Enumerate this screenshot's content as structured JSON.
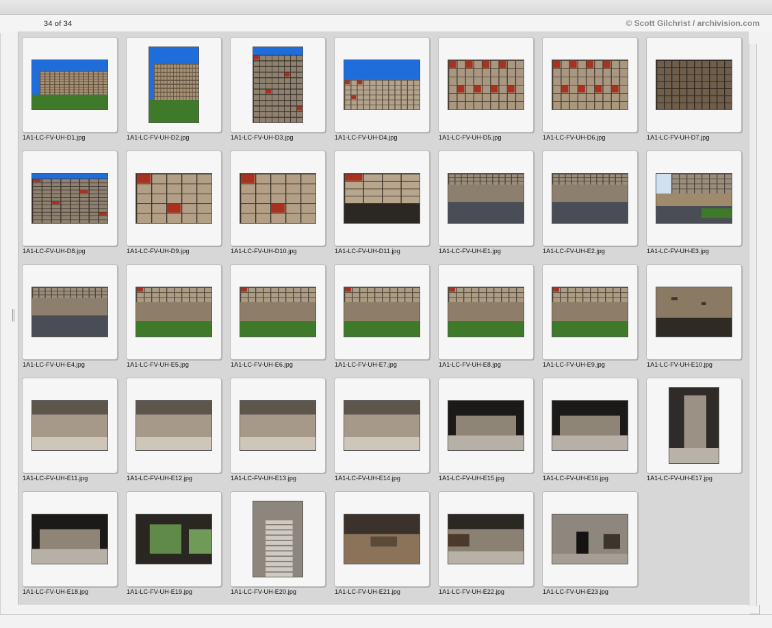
{
  "header": {
    "counter": "34 of 34",
    "credit": "© Scott Gilchrist / archivision.com"
  },
  "thumbnails": [
    {
      "filename": "1A1-LC-FV-UH-D1.jpg",
      "orientation": "landscape",
      "scene": "facade-sky-lawn"
    },
    {
      "filename": "1A1-LC-FV-UH-D2.jpg",
      "orientation": "portrait",
      "scene": "facade-sky-lawn"
    },
    {
      "filename": "1A1-LC-FV-UH-D3.jpg",
      "orientation": "portrait",
      "scene": "facade-grid"
    },
    {
      "filename": "1A1-LC-FV-UH-D4.jpg",
      "orientation": "landscape",
      "scene": "facade-sky-top"
    },
    {
      "filename": "1A1-LC-FV-UH-D5.jpg",
      "orientation": "landscape",
      "scene": "facade-grid-red"
    },
    {
      "filename": "1A1-LC-FV-UH-D6.jpg",
      "orientation": "landscape",
      "scene": "facade-grid-red"
    },
    {
      "filename": "1A1-LC-FV-UH-D7.jpg",
      "orientation": "landscape",
      "scene": "facade-grid-dark"
    },
    {
      "filename": "1A1-LC-FV-UH-D8.jpg",
      "orientation": "landscape",
      "scene": "facade-grid"
    },
    {
      "filename": "1A1-LC-FV-UH-D9.jpg",
      "orientation": "landscape",
      "scene": "balconies"
    },
    {
      "filename": "1A1-LC-FV-UH-D10.jpg",
      "orientation": "landscape",
      "scene": "balconies"
    },
    {
      "filename": "1A1-LC-FV-UH-D11.jpg",
      "orientation": "landscape",
      "scene": "balconies-dark"
    },
    {
      "filename": "1A1-LC-FV-UH-E1.jpg",
      "orientation": "landscape",
      "scene": "pilotis-road"
    },
    {
      "filename": "1A1-LC-FV-UH-E2.jpg",
      "orientation": "landscape",
      "scene": "pilotis-road"
    },
    {
      "filename": "1A1-LC-FV-UH-E3.jpg",
      "orientation": "landscape",
      "scene": "pilotis-road-green"
    },
    {
      "filename": "1A1-LC-FV-UH-E4.jpg",
      "orientation": "landscape",
      "scene": "pilotis-road"
    },
    {
      "filename": "1A1-LC-FV-UH-E5.jpg",
      "orientation": "landscape",
      "scene": "pilotis-lawn"
    },
    {
      "filename": "1A1-LC-FV-UH-E6.jpg",
      "orientation": "landscape",
      "scene": "pilotis-lawn"
    },
    {
      "filename": "1A1-LC-FV-UH-E7.jpg",
      "orientation": "landscape",
      "scene": "pilotis-lawn"
    },
    {
      "filename": "1A1-LC-FV-UH-E8.jpg",
      "orientation": "landscape",
      "scene": "pilotis-lawn"
    },
    {
      "filename": "1A1-LC-FV-UH-E9.jpg",
      "orientation": "landscape",
      "scene": "pilotis-lawn"
    },
    {
      "filename": "1A1-LC-FV-UH-E10.jpg",
      "orientation": "landscape",
      "scene": "concrete-wall"
    },
    {
      "filename": "1A1-LC-FV-UH-E11.jpg",
      "orientation": "landscape",
      "scene": "undercroft"
    },
    {
      "filename": "1A1-LC-FV-UH-E12.jpg",
      "orientation": "landscape",
      "scene": "undercroft"
    },
    {
      "filename": "1A1-LC-FV-UH-E13.jpg",
      "orientation": "landscape",
      "scene": "undercroft"
    },
    {
      "filename": "1A1-LC-FV-UH-E14.jpg",
      "orientation": "landscape",
      "scene": "undercroft"
    },
    {
      "filename": "1A1-LC-FV-UH-E15.jpg",
      "orientation": "landscape",
      "scene": "undercroft-dark"
    },
    {
      "filename": "1A1-LC-FV-UH-E16.jpg",
      "orientation": "landscape",
      "scene": "undercroft-dark"
    },
    {
      "filename": "1A1-LC-FV-UH-E17.jpg",
      "orientation": "portrait",
      "scene": "column"
    },
    {
      "filename": "1A1-LC-FV-UH-E18.jpg",
      "orientation": "landscape",
      "scene": "undercroft-dark"
    },
    {
      "filename": "1A1-LC-FV-UH-E19.jpg",
      "orientation": "landscape",
      "scene": "frame-green"
    },
    {
      "filename": "1A1-LC-FV-UH-E20.jpg",
      "orientation": "portrait",
      "scene": "stairs"
    },
    {
      "filename": "1A1-LC-FV-UH-E21.jpg",
      "orientation": "landscape",
      "scene": "concrete-detail"
    },
    {
      "filename": "1A1-LC-FV-UH-E22.jpg",
      "orientation": "landscape",
      "scene": "entrance"
    },
    {
      "filename": "1A1-LC-FV-UH-E23.jpg",
      "orientation": "landscape",
      "scene": "entrance-door"
    }
  ],
  "colors": {
    "sky": "#1f6ddb",
    "concrete": "#9a8a78",
    "lawn": "#3f7a2a",
    "red_panel": "#a8321f",
    "asphalt": "#4a4d55",
    "shadow": "#2b2723"
  }
}
